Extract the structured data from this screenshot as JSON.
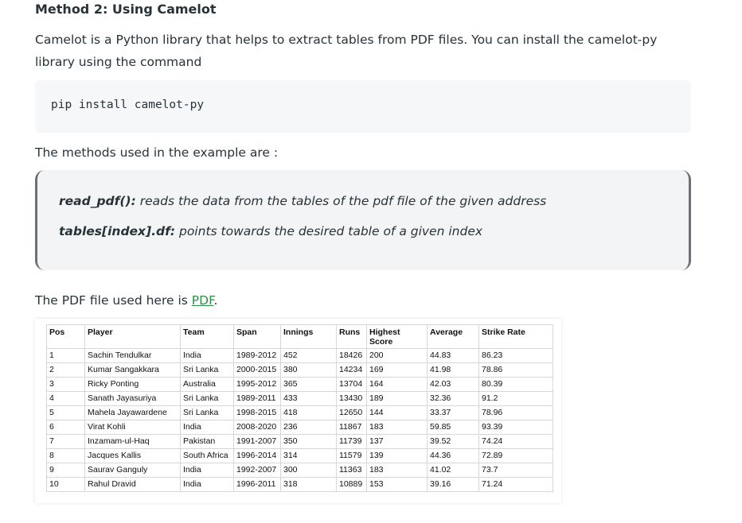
{
  "heading": "Method 2: Using Camelot",
  "intro": "Camelot is a Python library that helps to extract tables from PDF files. You can install the camelot-py library using the command",
  "code": "pip install camelot-py",
  "methods_intro": "The methods used in the example are :",
  "methods": [
    {
      "name": "read_pdf():",
      "desc": " reads the data from the tables of the pdf file of the given address"
    },
    {
      "name": "tables[index].df:",
      "desc": " points towards the desired table of a given index"
    }
  ],
  "pdf_line": {
    "prefix": "The PDF file used here is ",
    "link_text": "PDF",
    "suffix": "."
  },
  "pdf_table": {
    "headers": [
      "Pos",
      "Player",
      "Team",
      "Span",
      "Innings",
      "Runs",
      "Highest Score",
      "Average",
      "Strike Rate"
    ],
    "rows": [
      [
        "1",
        "Sachin Tendulkar",
        "India",
        "1989-2012",
        "452",
        "18426",
        "200",
        "44.83",
        "86.23"
      ],
      [
        "2",
        "Kumar Sangakkara",
        "Sri Lanka",
        "2000-2015",
        "380",
        "14234",
        "169",
        "41.98",
        "78.86"
      ],
      [
        "3",
        "Ricky Ponting",
        "Australia",
        "1995-2012",
        "365",
        "13704",
        "164",
        "42.03",
        "80.39"
      ],
      [
        "4",
        "Sanath Jayasuriya",
        "Sri Lanka",
        "1989-2011",
        "433",
        "13430",
        "189",
        "32.36",
        "91.2"
      ],
      [
        "5",
        "Mahela Jayawardene",
        "Sri Lanka",
        "1998-2015",
        "418",
        "12650",
        "144",
        "33.37",
        "78.96"
      ],
      [
        "6",
        "Virat Kohli",
        "India",
        "2008-2020",
        "236",
        "11867",
        "183",
        "59.85",
        "93.39"
      ],
      [
        "7",
        "Inzamam-ul-Haq",
        "Pakistan",
        "1991-2007",
        "350",
        "11739",
        "137",
        "39.52",
        "74.24"
      ],
      [
        "8",
        "Jacques Kallis",
        "South Africa",
        "1996-2014",
        "314",
        "11579",
        "139",
        "44.36",
        "72.89"
      ],
      [
        "9",
        "Saurav Ganguly",
        "India",
        "1992-2007",
        "300",
        "11363",
        "183",
        "41.02",
        "73.7"
      ],
      [
        "10",
        "Rahul Dravid",
        "India",
        "1996-2011",
        "318",
        "10889",
        "153",
        "39.16",
        "71.24"
      ]
    ]
  }
}
